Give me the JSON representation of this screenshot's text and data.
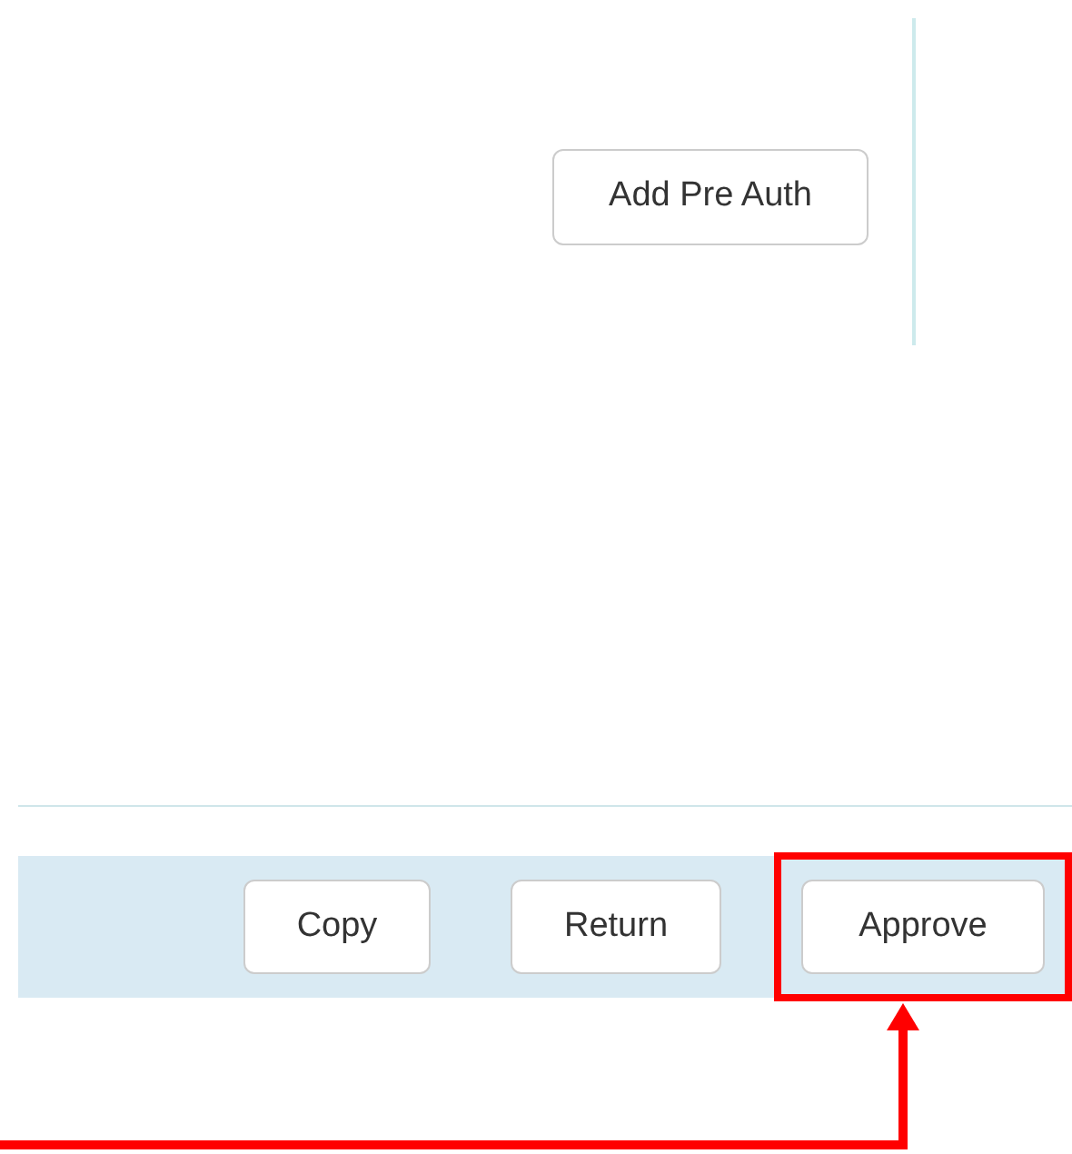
{
  "pre_auth_button": "Add Pre Auth",
  "footer_buttons": [
    {
      "label": "Copy",
      "highlighted": false
    },
    {
      "label": "Return",
      "highlighted": false
    },
    {
      "label": "Approve",
      "highlighted": true
    }
  ]
}
